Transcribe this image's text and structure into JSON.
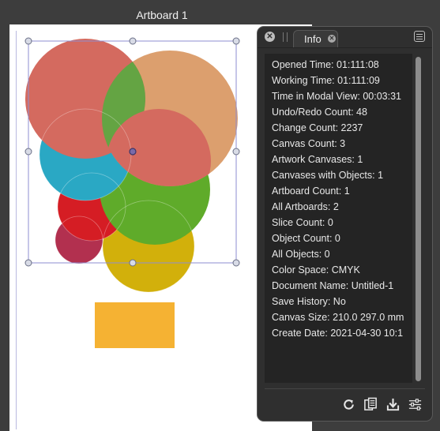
{
  "artboard": {
    "title": "Artboard 1"
  },
  "panel": {
    "tab_label": "Info",
    "info_rows": [
      "Opened Time: 01:111:08",
      "Working Time: 01:111:09",
      "Time in Modal View: 00:03:31",
      "Undo/Redo Count: 48",
      "Change Count: 2237",
      "Canvas Count: 3",
      "Artwork Canvases: 1",
      "Canvases with Objects: 1",
      "Artboard Count: 1",
      "All Artboards: 2",
      "Slice Count: 0",
      "Object Count: 0",
      "All Objects: 0",
      "Color Space: CMYK",
      "Document Name: Untitled-1",
      "Save History: No",
      "Canvas Size: 210.0 297.0 mm",
      "Create Date: 2021-04-30 10:1"
    ],
    "footer_icons": [
      "refresh-icon",
      "copy-icon",
      "export-icon",
      "settings-sliders-icon"
    ]
  },
  "colors": {
    "salmon": "#d46a5f",
    "peach": "#dc9f6e",
    "green_overlap": "#64a443",
    "cyan": "#2aa8c4",
    "green": "#5fab2a",
    "red": "#d51d24",
    "maroon": "#b2304f",
    "yellow": "#d2b00b",
    "orange_rect": "#f5b233"
  }
}
